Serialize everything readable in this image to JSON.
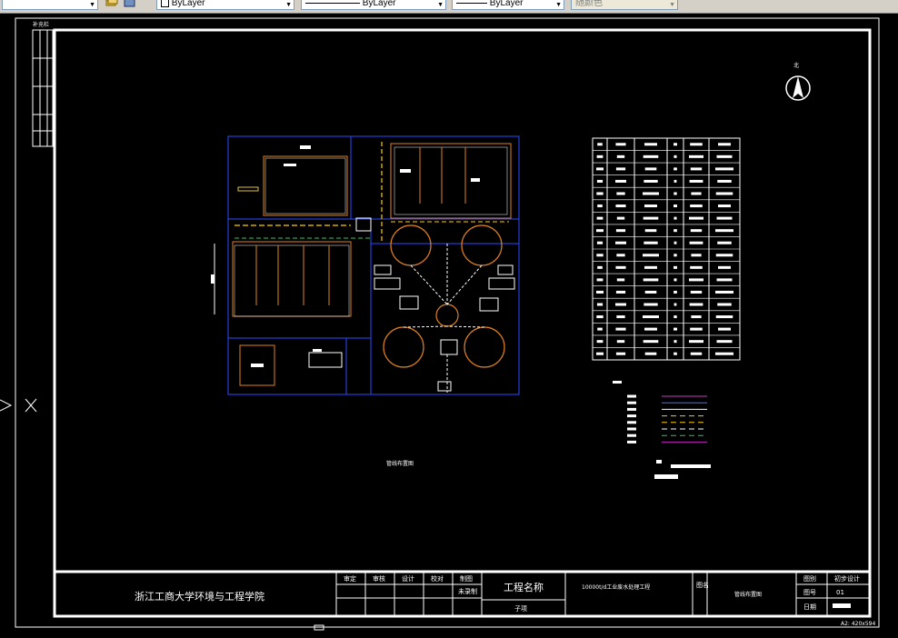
{
  "toolbar": {
    "layer_combo": "ByLayer",
    "linetype_combo": "ByLayer",
    "lineweight_combo": "ByLayer",
    "plotstyle_combo": "随颜色"
  },
  "drawing": {
    "side_strip_label": "补充栏",
    "north_label": "北",
    "plan_title": "管线布置图",
    "equipment_table": {
      "columns": 6,
      "rows": 18
    },
    "legend_lines": [
      {
        "color": "#c040c0"
      },
      {
        "color": "#4a6cff"
      },
      {
        "color": "#ffffff"
      },
      {
        "color": "#ffcc00"
      },
      {
        "color": "#ffcc00"
      },
      {
        "color": "#ffffff"
      },
      {
        "color": "#39c06a"
      },
      {
        "color": "#c020c0"
      }
    ]
  },
  "title_block": {
    "institution": "浙江工商大学环境与工程学院",
    "headers": [
      "审定",
      "审核",
      "设计",
      "校对",
      "制图"
    ],
    "sub_cell": "未录制",
    "project_label": "工程名称",
    "project_sub": "子项",
    "project_name": "10000t/d工业废水处理工程",
    "drawing_col_label": "图名",
    "drawing_name": "管线布置图",
    "stage_label": "图别",
    "stage_value": "初步设计",
    "sheet_label": "图号",
    "sheet_value": "01",
    "date_label": "日期",
    "paper_size": "A2: 420x594"
  }
}
